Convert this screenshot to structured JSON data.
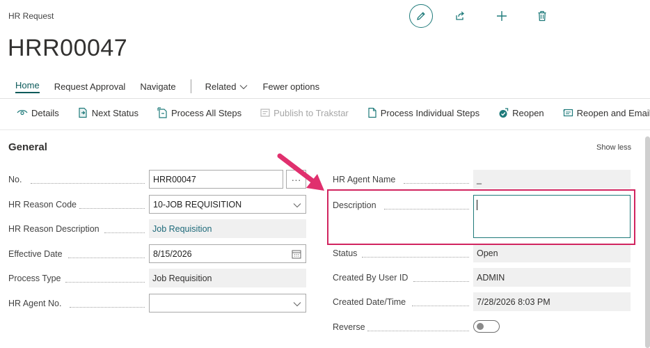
{
  "page": {
    "type_label": "HR Request",
    "record_title": "HRR00047"
  },
  "top_actions": {
    "edit_icon": "pencil-icon",
    "share_icon": "share-icon",
    "new_icon": "plus-icon",
    "delete_icon": "trash-icon"
  },
  "nav": {
    "home": "Home",
    "request_approval": "Request Approval",
    "navigate": "Navigate",
    "related": "Related",
    "fewer_options": "Fewer options"
  },
  "toolbar": {
    "details": "Details",
    "next_status": "Next Status",
    "process_all_steps": "Process All Steps",
    "publish_to_trakstar": "Publish to Trakstar",
    "process_individual_steps": "Process Individual Steps",
    "reopen": "Reopen",
    "reopen_and_email": "Reopen and Email"
  },
  "section": {
    "title": "General",
    "show_less": "Show less"
  },
  "left_fields": {
    "no": {
      "label": "No.",
      "value": "HRR00047",
      "assist": "···"
    },
    "reason_code": {
      "label": "HR Reason Code",
      "value": "10-JOB REQUISITION"
    },
    "reason_description": {
      "label": "HR Reason Description",
      "value": "Job Requisition"
    },
    "effective_date": {
      "label": "Effective Date",
      "value": "8/15/2026"
    },
    "process_type": {
      "label": "Process Type",
      "value": "Job Requisition"
    },
    "agent_no": {
      "label": "HR Agent No.",
      "value": ""
    }
  },
  "right_fields": {
    "agent_name": {
      "label": "HR Agent Name",
      "value": "_"
    },
    "description": {
      "label": "Description",
      "value": ""
    },
    "status": {
      "label": "Status",
      "value": "Open"
    },
    "created_by": {
      "label": "Created By User ID",
      "value": "ADMIN"
    },
    "created_datetime": {
      "label": "Created Date/Time",
      "value": "7/28/2026 8:03 PM"
    },
    "reverse": {
      "label": "Reverse",
      "value": false
    }
  },
  "colors": {
    "accent": "#1e7a7a",
    "annotation": "#e0306e"
  }
}
